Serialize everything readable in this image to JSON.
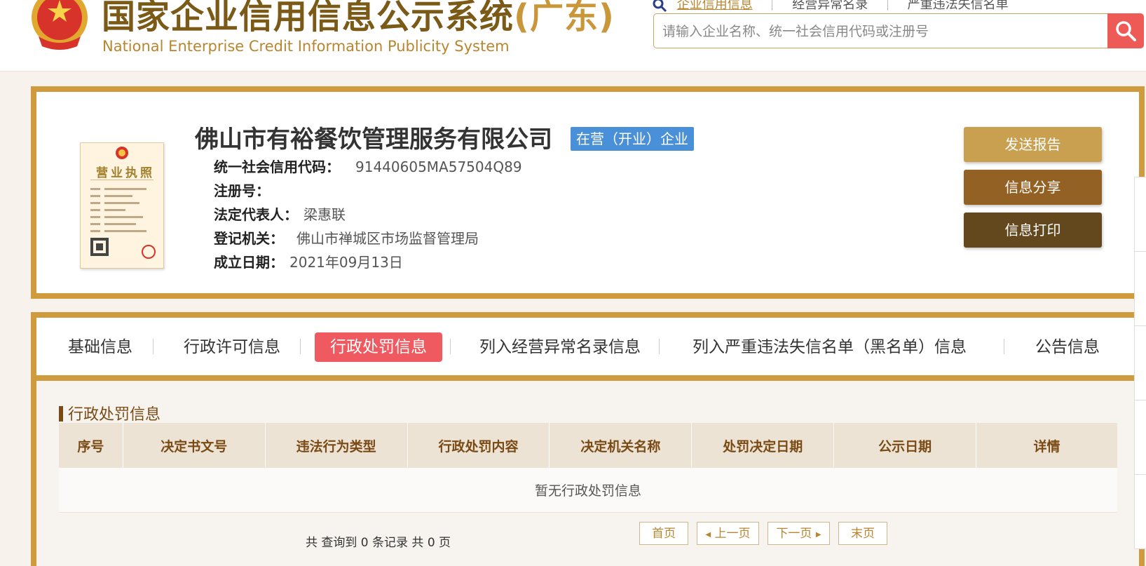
{
  "header": {
    "title_main": "国家企业信用信息公示系统",
    "title_province": "(广东)",
    "subtitle": "National Enterprise Credit Information Publicity System",
    "nav": [
      "企业信用信息",
      "经营异常名录",
      "严重违法失信名单"
    ],
    "search_placeholder": "请输入企业名称、统一社会信用代码或注册号"
  },
  "company": {
    "name": "佛山市有裕餐饮管理服务有限公司",
    "status": "在营（开业）企业",
    "fields": [
      {
        "key": "统一社会信用代码：",
        "value": "91440605MA57504Q89"
      },
      {
        "key": "注册号：",
        "value": ""
      },
      {
        "key": "法定代表人：",
        "value": "梁惠联"
      },
      {
        "key": "登记机关：",
        "value": "佛山市禅城区市场监督管理局"
      },
      {
        "key": "成立日期：",
        "value": "2021年09月13日"
      }
    ],
    "license_title": "营业执照"
  },
  "actions": {
    "send_report": "发送报告",
    "share": "信息分享",
    "print": "信息打印"
  },
  "tabs": [
    "基础信息",
    "行政许可信息",
    "行政处罚信息",
    "列入经营异常名录信息",
    "列入严重违法失信名单（黑名单）信息",
    "公告信息"
  ],
  "section": {
    "title": "行政处罚信息",
    "columns": [
      "序号",
      "决定书文号",
      "违法行为类型",
      "行政处罚内容",
      "决定机关名称",
      "处罚决定日期",
      "公示日期",
      "详情"
    ],
    "empty_text": "暂无行政处罚信息"
  },
  "pager": {
    "info": "共 查询到 0 条记录 共 0 页",
    "first": "首页",
    "prev": "上一页",
    "next": "下一页",
    "last": "末页"
  },
  "colors": {
    "gold": "#d09b3d",
    "brown_title": "#7a5a16",
    "active_tab": "#ee5a60",
    "status_blue": "#4a90d9",
    "btn_send": "#c9a050",
    "btn_share": "#946125",
    "btn_print": "#63471d"
  }
}
